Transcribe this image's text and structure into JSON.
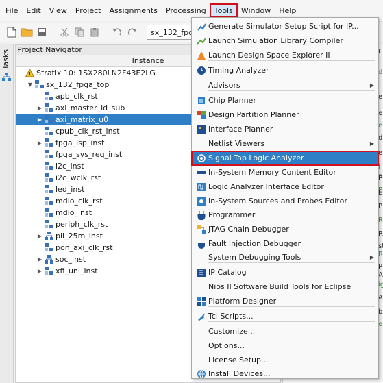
{
  "menubar": {
    "items": [
      "File",
      "Edit",
      "View",
      "Project",
      "Assignments",
      "Processing",
      "Tools",
      "Window",
      "Help"
    ]
  },
  "toolbar": {
    "project_combo": "sx_132_fpga_top"
  },
  "tasks": {
    "label": "Tasks"
  },
  "navigator": {
    "title": "Project Navigator",
    "column_header": "Instance",
    "rows": [
      {
        "text": "Stratix 10: 1SX280LN2F43E2LG",
        "icon": "warning-triangle-icon"
      },
      {
        "text": "sx_132_fpga_top",
        "icon": "hierarchy-icon"
      },
      {
        "text": "apb_clk_rst",
        "icon": "module-icon"
      },
      {
        "text": "axi_master_id_sub",
        "icon": "module-icon"
      },
      {
        "text": "axi_matrix_u0",
        "icon": "module-icon"
      },
      {
        "text": "cpub_clk_rst_inst",
        "icon": "module-icon"
      },
      {
        "text": "fpga_lsp_inst",
        "icon": "module-icon"
      },
      {
        "text": "fpga_sys_reg_inst",
        "icon": "module-icon"
      },
      {
        "text": "i2c_inst",
        "icon": "module-icon"
      },
      {
        "text": "i2c_wclk_rst",
        "icon": "module-icon"
      },
      {
        "text": "led_inst",
        "icon": "module-icon"
      },
      {
        "text": "mdio_clk_rst",
        "icon": "module-icon"
      },
      {
        "text": "mdio_inst",
        "icon": "module-icon"
      },
      {
        "text": "periph_clk_rst",
        "icon": "module-icon"
      },
      {
        "text": "pll_25m_inst",
        "icon": "pll-icon"
      },
      {
        "text": "pon_axi_clk_rst",
        "icon": "module-icon"
      },
      {
        "text": "soc_inst",
        "icon": "pll-icon"
      },
      {
        "text": "xfi_uni_inst",
        "icon": "module-icon"
      }
    ]
  },
  "tools_menu": {
    "items": [
      {
        "label": "Generate Simulator Setup Script for IP...",
        "icon": "script-gen-icon"
      },
      {
        "label": "Launch Simulation Library Compiler",
        "icon": "simulation-icon"
      },
      {
        "label": "Launch Design Space Explorer II",
        "icon": "explorer-icon"
      },
      {
        "label": "Timing Analyzer",
        "icon": "clock-icon"
      },
      {
        "label": "Advisors",
        "icon": ""
      },
      {
        "label": "Chip Planner",
        "icon": "chip-planner-icon"
      },
      {
        "label": "Design Partition Planner",
        "icon": "partition-icon"
      },
      {
        "label": "Interface Planner",
        "icon": "interface-planner-icon"
      },
      {
        "label": "Netlist Viewers",
        "icon": ""
      },
      {
        "label": "Signal Tap Logic Analyzer",
        "icon": "signal-tap-icon"
      },
      {
        "label": "In-System Memory Content Editor",
        "icon": "memory-editor-icon"
      },
      {
        "label": "Logic Analyzer Interface Editor",
        "icon": "logic-analyzer-icon"
      },
      {
        "label": "In-System Sources and Probes Editor",
        "icon": "sources-probes-icon"
      },
      {
        "label": "Programmer",
        "icon": "programmer-icon"
      },
      {
        "label": "JTAG Chain Debugger",
        "icon": "jtag-icon"
      },
      {
        "label": "Fault Injection Debugger",
        "icon": "fault-injection-icon"
      },
      {
        "label": "System Debugging Tools",
        "icon": ""
      },
      {
        "label": "IP Catalog",
        "icon": "ip-catalog-icon"
      },
      {
        "label": "Nios II Software Build Tools for Eclipse",
        "icon": ""
      },
      {
        "label": "Platform Designer",
        "icon": "platform-designer-icon"
      },
      {
        "label": "Tcl Scripts...",
        "icon": "tcl-icon"
      },
      {
        "label": "Customize...",
        "icon": ""
      },
      {
        "label": "Options...",
        "icon": ""
      },
      {
        "label": "License Setup...",
        "icon": ""
      },
      {
        "label": "Install Devices...",
        "icon": "install-devices-icon"
      }
    ]
  },
  "right_panel": {
    "fragments": [
      "d",
      "en",
      "e",
      "en",
      "d",
      "en",
      "l",
      "n",
      "P",
      "P",
      "E",
      "P",
      "R",
      "R",
      "st",
      "R",
      "P",
      "A",
      "ig",
      "A",
      "bu",
      "e"
    ]
  },
  "colors": {
    "accent": "#2f7fc6",
    "highlight_box": "#d0101a",
    "green_text": "#3a9a3a"
  }
}
